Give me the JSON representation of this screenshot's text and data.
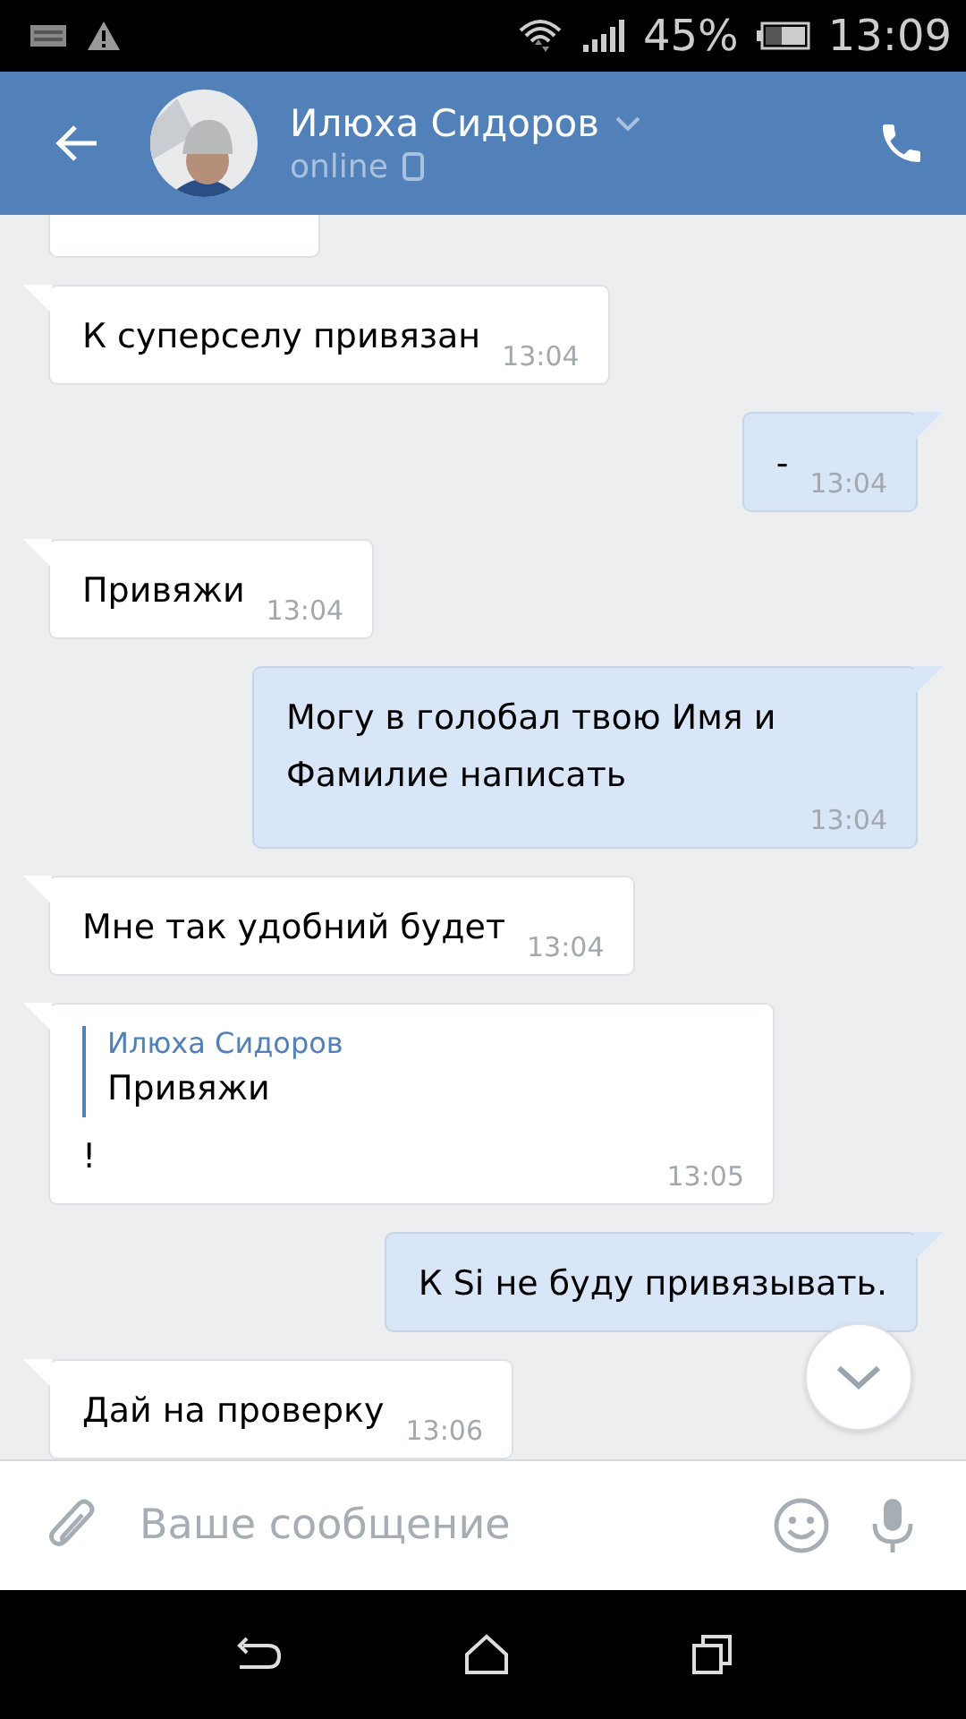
{
  "status_bar": {
    "battery": "45%",
    "time": "13:09"
  },
  "header": {
    "name": "Илюха Сидоров",
    "status": "online"
  },
  "messages": [
    {
      "kind": "clipped",
      "outgoing": false
    },
    {
      "kind": "text",
      "outgoing": false,
      "text": "К суперселу привязан",
      "time": "13:04"
    },
    {
      "kind": "text",
      "outgoing": true,
      "text": "-",
      "time": "13:04"
    },
    {
      "kind": "text",
      "outgoing": false,
      "text": "Привяжи",
      "time": "13:04"
    },
    {
      "kind": "text",
      "outgoing": true,
      "text": "Могу в голобал твою Имя и Фамилие написать",
      "time": "13:04"
    },
    {
      "kind": "text",
      "outgoing": false,
      "text": "Мне так удобний будет",
      "time": "13:04"
    },
    {
      "kind": "reply",
      "outgoing": false,
      "quote_author": "Илюха Сидоров",
      "quote_text": "Привяжи",
      "text": "!",
      "time": "13:05"
    },
    {
      "kind": "text",
      "outgoing": true,
      "text": "К Si не буду привязывать."
    },
    {
      "kind": "text",
      "outgoing": false,
      "text": "Дай на проверку",
      "time": "13:06"
    }
  ],
  "composer": {
    "placeholder": "Ваше сообщение"
  }
}
